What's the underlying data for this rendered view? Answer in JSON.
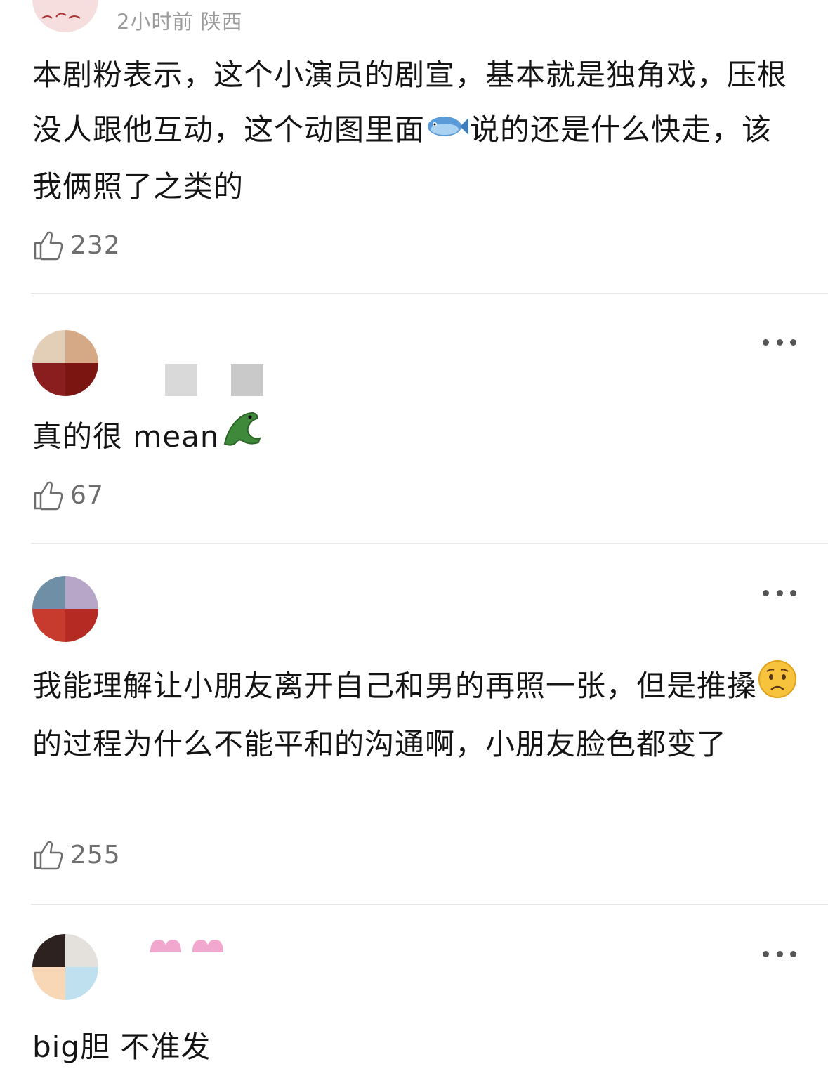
{
  "comments": [
    {
      "meta": "2小时前 陕西",
      "text": "本剧粉表示，这个小演员的剧宣，基本就是独角戏，压根没人跟他互动，这个动图里面",
      "emoji": "fish-emoji",
      "text_after": "说的还是什么快走，该我俩照了之类的",
      "likes": "232"
    },
    {
      "text": "真的很 mean",
      "emoji": "crocodile-emoji",
      "likes": "67"
    },
    {
      "text": "我能理解让小朋友离开自己和男的再照一张，但是推搡",
      "emoji": "worried-face-emoji",
      "text_after": "的过程为什么不能平和的沟通啊，小朋友脸色都变了",
      "likes": "255"
    },
    {
      "text": "big胆 不准发"
    }
  ],
  "colors": {
    "text": "#141414",
    "meta": "#9b9b9b",
    "divider": "#e6e6e6",
    "like": "#6e6e6e"
  }
}
